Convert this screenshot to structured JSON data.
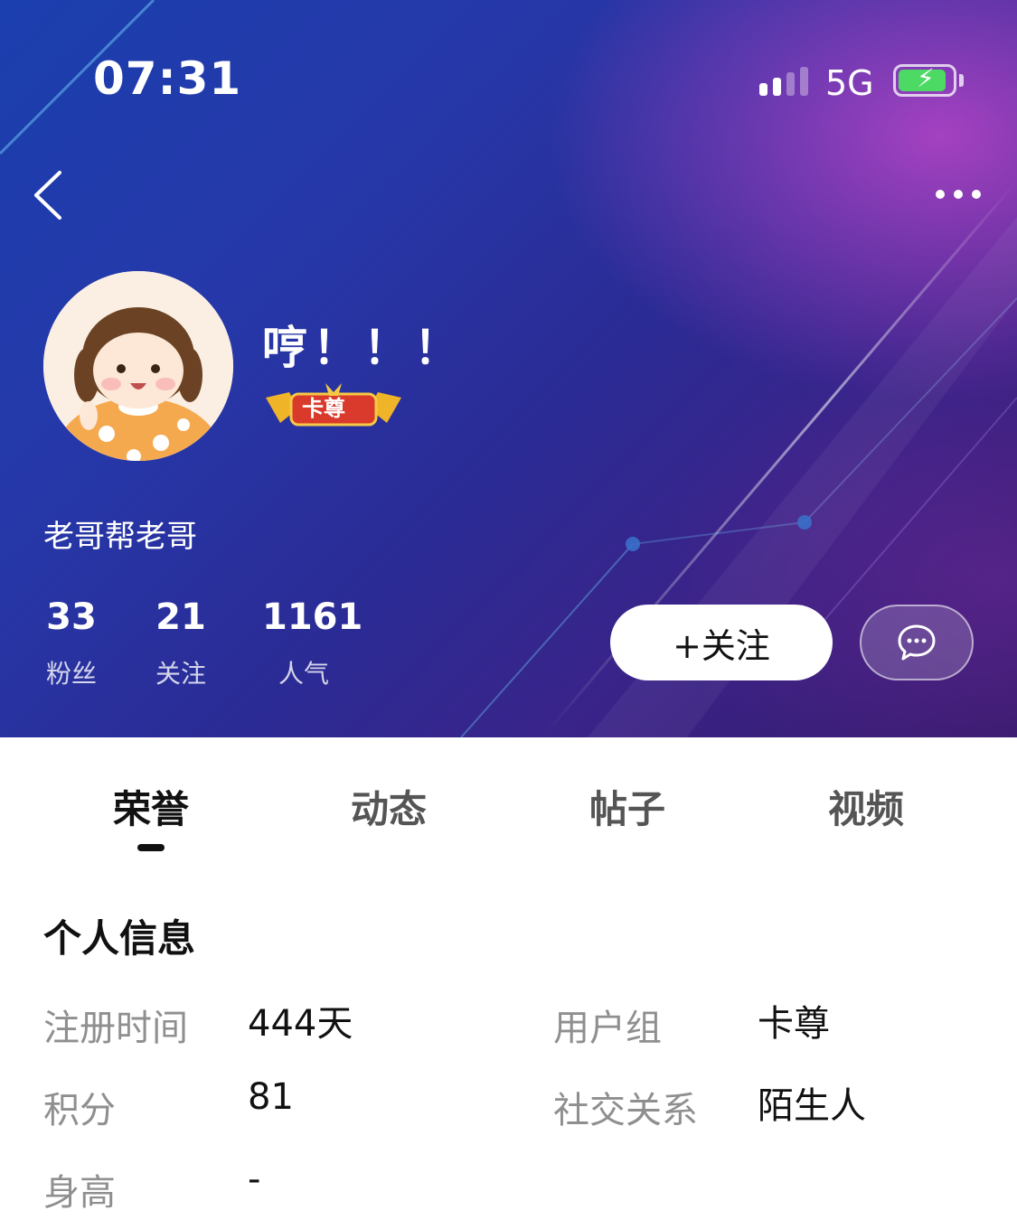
{
  "status_bar": {
    "time": "07:31",
    "network": "5G",
    "battery_level": 0.9
  },
  "header": {
    "back_icon": "chevron-left-icon",
    "more_icon": "more-dots-icon"
  },
  "profile": {
    "username": "哼！！！",
    "rank_badge": "卡尊",
    "subtitle": "老哥帮老哥",
    "stats": [
      {
        "value": "33",
        "label": "粉丝"
      },
      {
        "value": "21",
        "label": "关注"
      },
      {
        "value": "1161",
        "label": "人气"
      }
    ],
    "follow_label": "+关注",
    "chat_icon": "chat-bubble-icon"
  },
  "tabs": [
    {
      "label": "荣誉",
      "active": true
    },
    {
      "label": "动态",
      "active": false
    },
    {
      "label": "帖子",
      "active": false
    },
    {
      "label": "视频",
      "active": false
    }
  ],
  "personal_info": {
    "title": "个人信息",
    "fields": [
      {
        "label": "注册时间",
        "value": "444天"
      },
      {
        "label": "用户组",
        "value": "卡尊"
      },
      {
        "label": "积分",
        "value": "81"
      },
      {
        "label": "社交关系",
        "value": "陌生人"
      },
      {
        "label": "身高",
        "value": "-"
      }
    ]
  },
  "colors": {
    "accent_follow_bg": "#ffffff",
    "battery_green": "#4cd964",
    "label_gray": "#8f8f8f"
  }
}
